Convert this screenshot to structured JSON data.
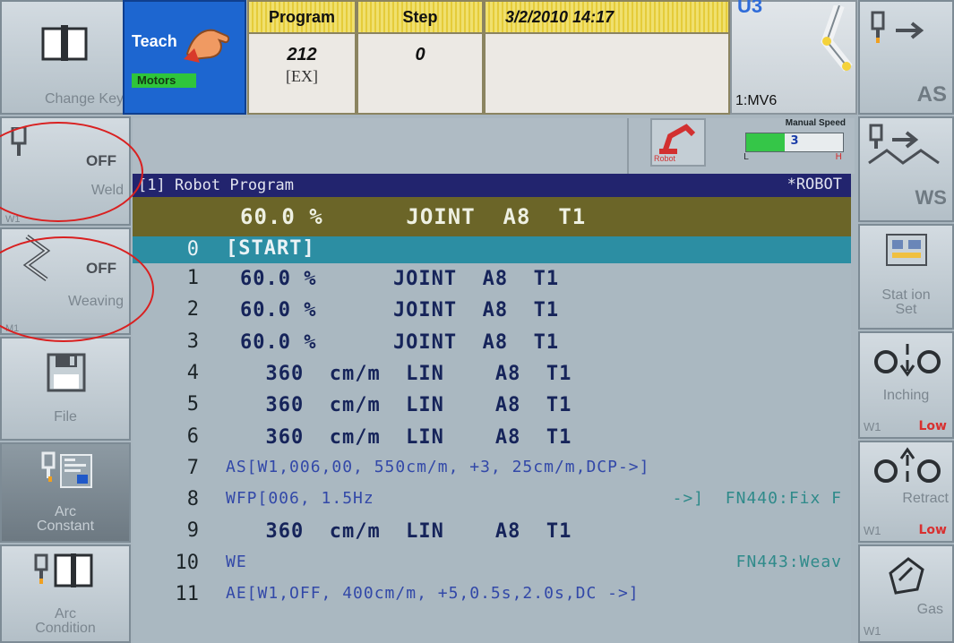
{
  "left_buttons": [
    {
      "label": "Change Key",
      "icon": "book-icon"
    },
    {
      "label": "Weld",
      "state": "OFF",
      "sub": "W1",
      "icon": "torch-icon"
    },
    {
      "label": "Weaving",
      "state": "OFF",
      "sub": "M1",
      "icon": "weave-icon"
    },
    {
      "label": "File",
      "icon": "floppy-icon"
    },
    {
      "label": "Arc\nConstant",
      "icon": "torch-display-icon"
    },
    {
      "label": "Arc\nCondition",
      "icon": "torch-book-icon"
    }
  ],
  "right_buttons": [
    {
      "label": "AS",
      "icon": "torch-arrow-icon"
    },
    {
      "label": "WS",
      "icon": "weave-arrow-icon"
    },
    {
      "label": "Stat ion\nSet",
      "icon": "station-icon"
    },
    {
      "label": "Inching",
      "sub": "W1",
      "level": "Low",
      "icon": "inching-icon"
    },
    {
      "label": "Retract",
      "sub": "W1",
      "level": "Low",
      "icon": "retract-icon"
    },
    {
      "label": "Gas",
      "sub": "W1",
      "icon": "gas-icon"
    }
  ],
  "header": {
    "mode": "Teach",
    "motors": "Motors",
    "program_label": "Program",
    "program_value": "212",
    "program_sub": "[EX]",
    "step_label": "Step",
    "step_value": "0",
    "datetime": "3/2/2010  14:17",
    "robot_id": "U3",
    "robot_model": "1:MV6"
  },
  "status": {
    "robot_button": "Robot",
    "manual_speed_label": "Manual Speed",
    "manual_speed_value": "3",
    "speed_min": "L",
    "speed_max": "H",
    "speed_level": 0.4
  },
  "program": {
    "title": "[1] Robot Program",
    "robot_tag": "*ROBOT",
    "selected_line": "60.0 %      JOINT  A8  T1",
    "start_no": "0",
    "start_text": "[START]",
    "lines": [
      {
        "no": "1",
        "text": "60.0 %      JOINT  A8  T1",
        "color": "#16245a"
      },
      {
        "no": "2",
        "text": "60.0 %      JOINT  A8  T1",
        "color": "#16245a"
      },
      {
        "no": "3",
        "text": "60.0 %      JOINT  A8  T1",
        "color": "#16245a"
      },
      {
        "no": "4",
        "text": "  360  cm/m  LIN    A8  T1",
        "color": "#16245a"
      },
      {
        "no": "5",
        "text": "  360  cm/m  LIN    A8  T1",
        "color": "#16245a"
      },
      {
        "no": "6",
        "text": "  360  cm/m  LIN    A8  T1",
        "color": "#16245a"
      },
      {
        "no": "7",
        "text": "AS[W1,006,00, 550cm/m, +3, 25cm/m,DCP->]",
        "color": "#3248a8"
      },
      {
        "no": "8",
        "text": "WFP[006, 1.5Hz",
        "text2": "->]  FN440:Fix F",
        "color": "#3248a8"
      },
      {
        "no": "9",
        "text": "  360  cm/m  LIN    A8  T1",
        "color": "#16245a"
      },
      {
        "no": "10",
        "text": "WE",
        "text2": "FN443:Weav",
        "color": "#3248a8"
      },
      {
        "no": "11",
        "text": "AE[W1,OFF, 400cm/m, +5,0.5s,2.0s,DC ->]",
        "color": "#3248a8"
      }
    ]
  }
}
